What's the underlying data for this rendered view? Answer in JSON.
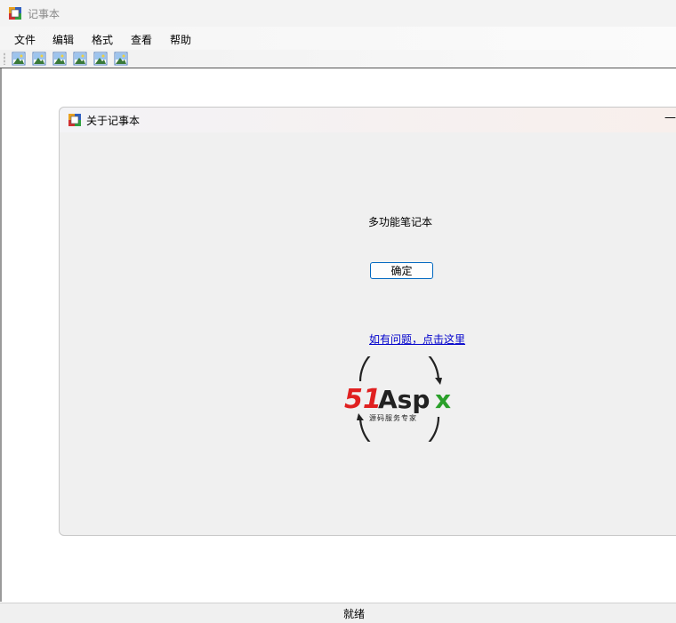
{
  "window": {
    "title": "记事本"
  },
  "menu": {
    "items": [
      "文件",
      "编辑",
      "格式",
      "查看",
      "帮助"
    ]
  },
  "toolbar": {
    "buttons": [
      "image-icon",
      "image-icon",
      "image-icon",
      "image-icon",
      "image-icon",
      "image-icon"
    ]
  },
  "about_dialog": {
    "title": "关于记事本",
    "product_name": "多功能笔记本",
    "ok_label": "确定",
    "help_link": "如有问题，点击这里",
    "logo": {
      "brand_red": "51",
      "brand_dark": "Aspx",
      "tagline": "源码服务专家"
    }
  },
  "status": {
    "text": "就绪"
  },
  "colors": {
    "accent": "#0067c0",
    "link": "#0000cc",
    "logo_red": "#e02020",
    "logo_green": "#2aa02a"
  }
}
